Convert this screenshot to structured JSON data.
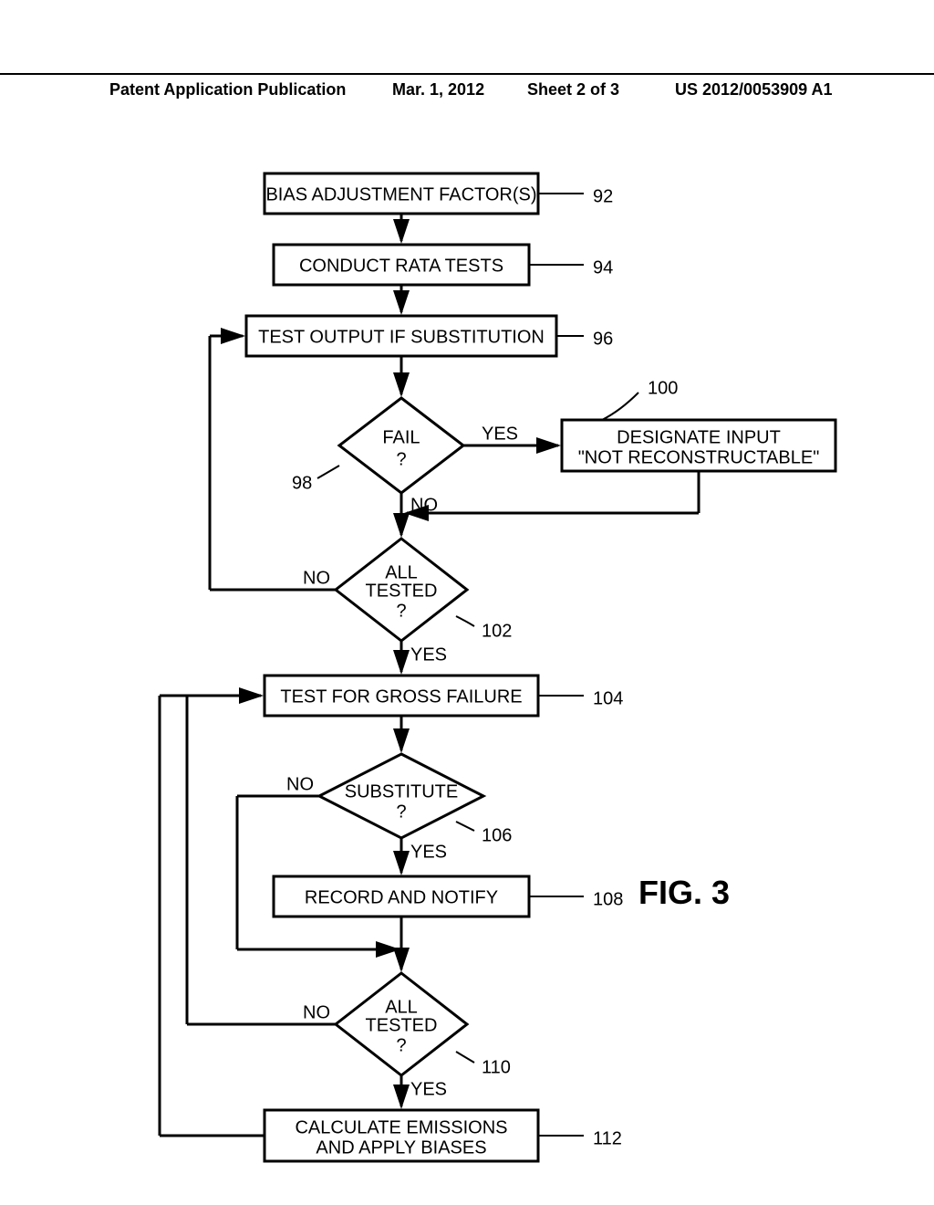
{
  "header": {
    "left": "Patent Application Publication",
    "date": "Mar. 1, 2012",
    "sheet": "Sheet 2 of 3",
    "pubno": "US 2012/0053909 A1"
  },
  "figure_label": "FIG. 3",
  "boxes": {
    "b92": "BIAS ADJUSTMENT FACTOR(S)",
    "b94": "CONDUCT RATA TESTS",
    "b96": "TEST OUTPUT IF SUBSTITUTION",
    "b100_l1": "DESIGNATE INPUT",
    "b100_l2": "\"NOT RECONSTRUCTABLE\"",
    "b104": "TEST FOR GROSS FAILURE",
    "b108": "RECORD AND NOTIFY",
    "b112_l1": "CALCULATE EMISSIONS",
    "b112_l2": "AND APPLY BIASES"
  },
  "decisions": {
    "d98_l1": "FAIL",
    "d98_l2": "?",
    "d102_l1": "ALL",
    "d102_l2": "TESTED",
    "d102_l3": "?",
    "d106_l1": "SUBSTITUTE",
    "d106_l2": "?",
    "d110_l1": "ALL",
    "d110_l2": "TESTED",
    "d110_l3": "?"
  },
  "edge_labels": {
    "yes": "YES",
    "no": "NO"
  },
  "refs": {
    "r92": "92",
    "r94": "94",
    "r96": "96",
    "r98": "98",
    "r100": "100",
    "r102": "102",
    "r104": "104",
    "r106": "106",
    "r108": "108",
    "r110": "110",
    "r112": "112"
  }
}
